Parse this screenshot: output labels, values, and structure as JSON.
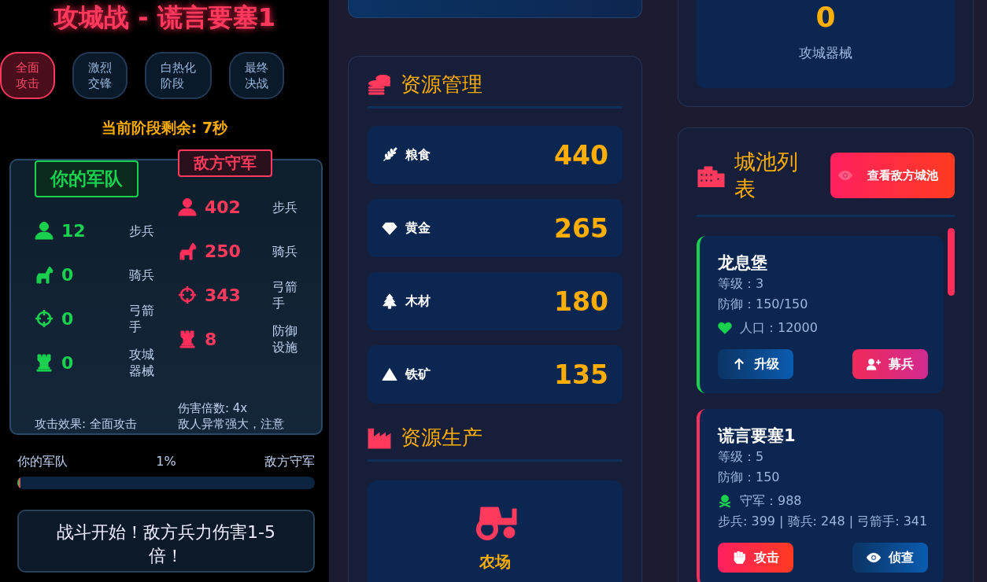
{
  "title": "攻城战 - 谎言要塞1",
  "phases": [
    {
      "label": "全面攻击",
      "selected": true
    },
    {
      "label": "激烈交锋",
      "selected": false
    },
    {
      "label": "白热化阶段",
      "selected": false
    },
    {
      "label": "最终决战",
      "selected": false
    }
  ],
  "timer": "当前阶段剩余: 7秒",
  "battle": {
    "armies": [
      {
        "kind": "player",
        "heading": "你的军队",
        "units": [
          {
            "kind": "infantry",
            "count": "12",
            "label": "步兵"
          },
          {
            "kind": "cavalry",
            "count": "0",
            "label": "骑兵"
          },
          {
            "kind": "archer",
            "count": "0",
            "label": "弓箭手"
          },
          {
            "kind": "siege",
            "count": "0",
            "label": "攻城器械"
          }
        ],
        "notes": [
          "攻击效果: 全面攻击"
        ]
      },
      {
        "kind": "enemy",
        "heading": "敌方守军",
        "units": [
          {
            "kind": "infantry",
            "count": "402",
            "label": "步兵"
          },
          {
            "kind": "cavalry",
            "count": "250",
            "label": "骑兵"
          },
          {
            "kind": "archer",
            "count": "343",
            "label": "弓箭手"
          },
          {
            "kind": "siege",
            "count": "8",
            "label": "防御设施"
          }
        ],
        "notes": [
          "伤害倍数: 4x",
          "敌人异常强大，注意"
        ]
      }
    ],
    "progress": {
      "left_label": "你的军队",
      "percent": "1%",
      "right_label": "敌方守军",
      "level": 0.01
    },
    "log": "战斗开始！敌方兵力伤害1-5倍！"
  },
  "resources": {
    "heading": "资源管理",
    "items": [
      {
        "kind": "grain",
        "name": "粮食",
        "amount": "440"
      },
      {
        "kind": "gold",
        "name": "黄金",
        "amount": "265"
      },
      {
        "kind": "wood",
        "name": "木材",
        "amount": "180"
      },
      {
        "kind": "iron",
        "name": "铁矿",
        "amount": "135"
      }
    ]
  },
  "production": {
    "heading": "资源生产",
    "buildings": [
      {
        "kind": "farm",
        "name": "农场"
      }
    ]
  },
  "top_stat": {
    "value": "0",
    "label": "攻城器械"
  },
  "cities": {
    "heading": "城池列表",
    "view_button": "查看敌方城池",
    "items": [
      {
        "kind": "own",
        "name": "龙息堡",
        "level": "等级：3",
        "defense": "防御：150/150",
        "stat": {
          "kind": "population",
          "text": "人口：12000"
        },
        "actions": [
          {
            "kind": "upgrade",
            "label": "升级"
          },
          {
            "kind": "recruit",
            "label": "募兵"
          }
        ]
      },
      {
        "kind": "enemy",
        "name": "谎言要塞1",
        "level": "等级：5",
        "defense": "防御：150",
        "stat": {
          "kind": "garrison",
          "text": "守军：988"
        },
        "troops": "步兵: 399 | 骑兵: 248 | 弓箭手: 341",
        "actions": [
          {
            "kind": "attack",
            "label": "攻击"
          },
          {
            "kind": "scout",
            "label": "侦查"
          }
        ]
      }
    ]
  }
}
